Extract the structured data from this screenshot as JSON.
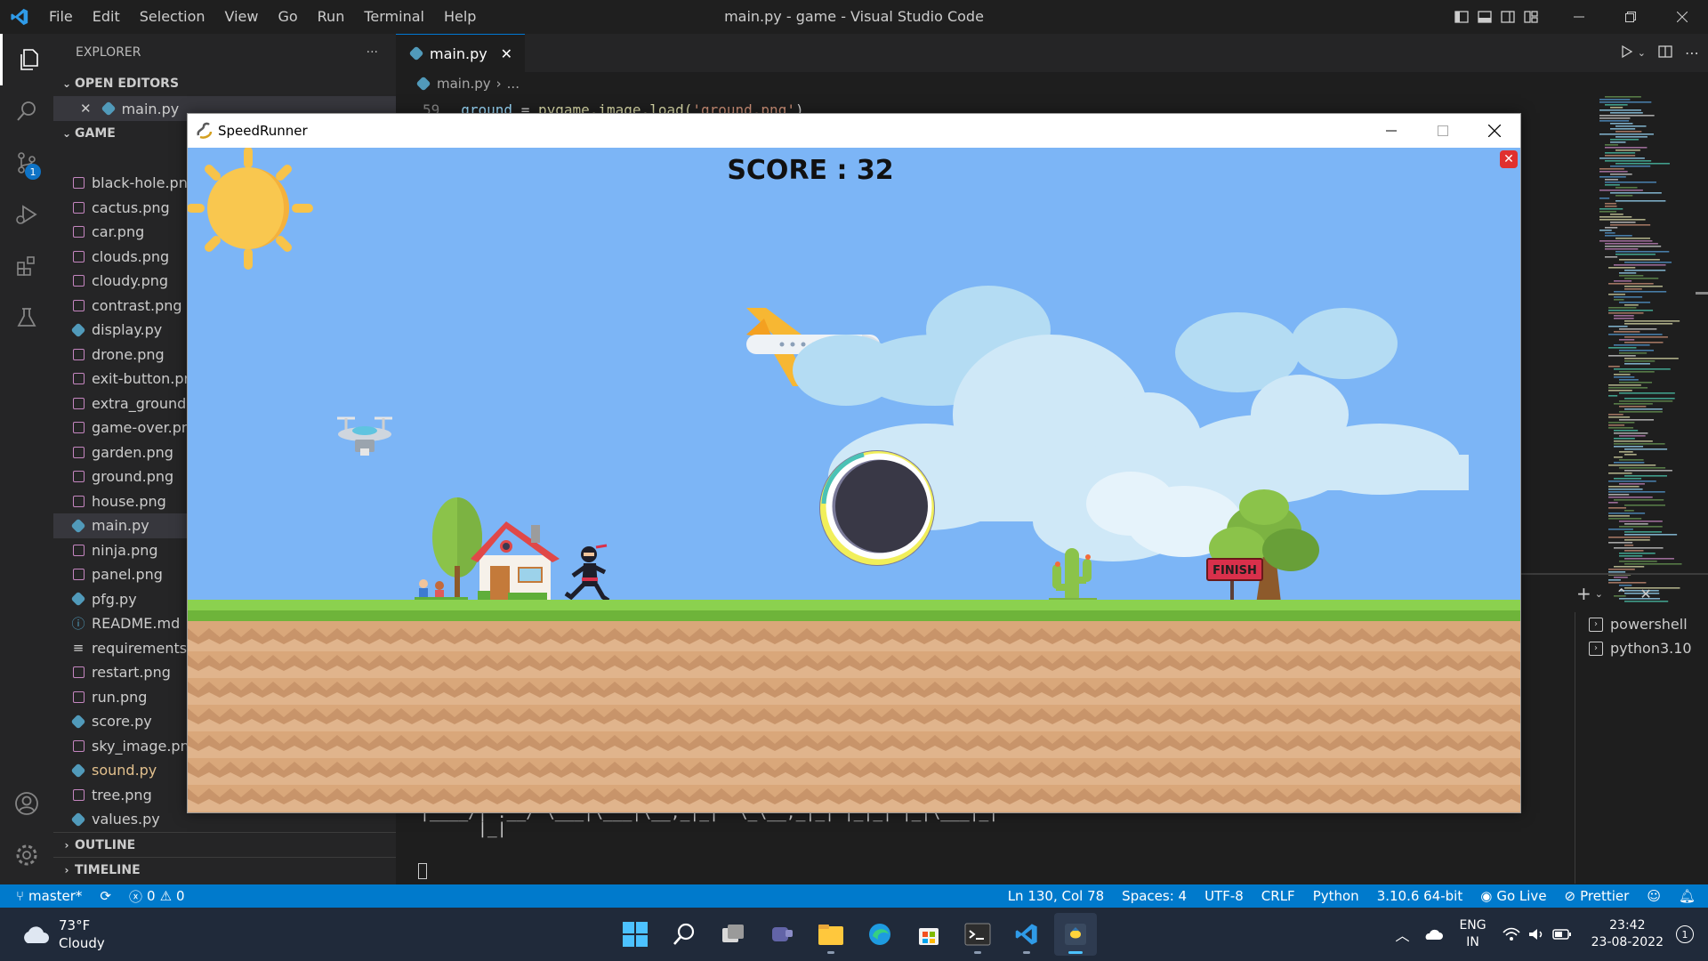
{
  "titlebar": {
    "menu": [
      "File",
      "Edit",
      "Selection",
      "View",
      "Go",
      "Run",
      "Terminal",
      "Help"
    ],
    "window_title": "main.py - game - Visual Studio Code"
  },
  "activitybar": {
    "source_control_badge": "1"
  },
  "sidebar": {
    "title": "EXPLORER",
    "more": "···",
    "open_editors_label": "OPEN EDITORS",
    "open_editor_file": "main.py",
    "folder_label": "GAME",
    "files": [
      {
        "name": "black-hole.png",
        "type": "image"
      },
      {
        "name": "cactus.png",
        "type": "image"
      },
      {
        "name": "car.png",
        "type": "image"
      },
      {
        "name": "clouds.png",
        "type": "image"
      },
      {
        "name": "cloudy.png",
        "type": "image"
      },
      {
        "name": "contrast.png",
        "type": "image"
      },
      {
        "name": "display.py",
        "type": "python"
      },
      {
        "name": "drone.png",
        "type": "image"
      },
      {
        "name": "exit-button.png",
        "type": "image"
      },
      {
        "name": "extra_ground.png",
        "type": "image"
      },
      {
        "name": "game-over.png",
        "type": "image"
      },
      {
        "name": "garden.png",
        "type": "image"
      },
      {
        "name": "ground.png",
        "type": "image"
      },
      {
        "name": "house.png",
        "type": "image"
      },
      {
        "name": "main.py",
        "type": "python"
      },
      {
        "name": "ninja.png",
        "type": "image"
      },
      {
        "name": "panel.png",
        "type": "image"
      },
      {
        "name": "pfg.py",
        "type": "python"
      },
      {
        "name": "README.md",
        "type": "info"
      },
      {
        "name": "requirements.txt",
        "type": "text"
      },
      {
        "name": "restart.png",
        "type": "image"
      },
      {
        "name": "run.png",
        "type": "image"
      },
      {
        "name": "score.py",
        "type": "python"
      },
      {
        "name": "sky_image.png",
        "type": "image"
      },
      {
        "name": "sound.py",
        "type": "python-modified"
      },
      {
        "name": "tree.png",
        "type": "image"
      },
      {
        "name": "values.py",
        "type": "python"
      }
    ],
    "outline_label": "OUTLINE",
    "timeline_label": "TIMELINE"
  },
  "editor": {
    "tab_label": "main.py",
    "breadcrumb_file": "main.py",
    "breadcrumb_more": "...",
    "line_number": "59",
    "code_var": "ground",
    "code_eq": " = ",
    "code_call": "pygame.image.load(",
    "code_str": "'ground.png'",
    "code_close": ")"
  },
  "terminal": {
    "ascii_line1": "|____/| .__/ \\___|\\___|\\__,_|_|  \\_\\__,_|_| |_|_| |_|\\___|_|",
    "ascii_line2": "      |_|",
    "shells": [
      "powershell",
      "python3.10"
    ]
  },
  "game": {
    "window_title": "SpeedRunner",
    "score_label": "SCORE : 32",
    "finish_sign": "FINISH"
  },
  "statusbar": {
    "branch": "master*",
    "errors": "0",
    "warnings": "0",
    "position": "Ln 130, Col 78",
    "spaces": "Spaces: 4",
    "encoding": "UTF-8",
    "eol": "CRLF",
    "language": "Python",
    "interpreter": "3.10.6 64-bit",
    "go_live": "Go Live",
    "prettier": "Prettier"
  },
  "taskbar": {
    "temp": "73°F",
    "condition": "Cloudy",
    "lang_line1": "ENG",
    "lang_line2": "IN",
    "time": "23:42",
    "date": "23-08-2022",
    "notif_count": "1"
  },
  "colors": {
    "accent": "#007acc",
    "sky": "#7cb5f6",
    "grass": "#7ac943",
    "dirt": "#d9a77a"
  }
}
